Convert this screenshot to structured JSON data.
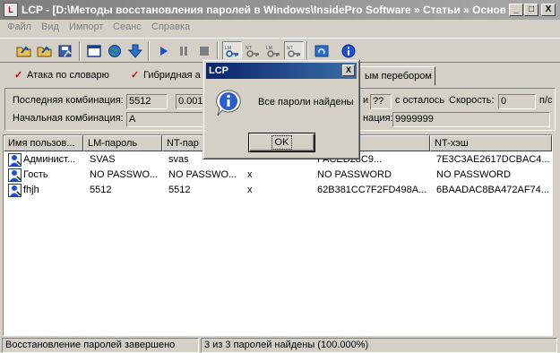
{
  "window": {
    "app_name": "LCP",
    "title": "LCP - [D:\\Методы восстановления паролей в Windows\\InsidePro Software » Статьи » Основ...",
    "controls": {
      "minimize": "_",
      "maximize": "□",
      "close": "X"
    }
  },
  "menu": [
    "Файл",
    "Вид",
    "Импорт",
    "Сеанс",
    "Справка"
  ],
  "toolbar": {
    "icons": [
      "open-folder-icon",
      "open-folder-icon",
      "save-icon",
      "new-window-icon",
      "globe-icon",
      "download-icon",
      "play-icon",
      "pause-icon",
      "stop-icon",
      "lm-key-icon",
      "nt-key-icon",
      "lm-nt-key-icon",
      "nt-key-icon",
      "refresh-icon",
      "info-icon"
    ]
  },
  "tabs": [
    {
      "label": "Атака по словарю",
      "checked": true
    },
    {
      "label": "Гибридная а",
      "checked": true
    },
    {
      "label": "ым перебором",
      "checked": false,
      "active": true
    }
  ],
  "stats": {
    "last_combination_label": "Последняя комбинация:",
    "last_combination_value": "5512",
    "progress_value": "0.001",
    "remaining_label_prefix": "и",
    "remaining_value": "??",
    "remaining_label": "с осталось",
    "speed_label": "Скорость:",
    "speed_value": "0",
    "speed_unit": "п/с",
    "start_combination_label": "Начальная комбинация:",
    "start_combination_value": "A",
    "end_combination_label": "нация:",
    "end_combination_value": "9999999"
  },
  "table": {
    "columns": [
      "Имя пользов...",
      "LM-пароль",
      "NT-пар",
      "",
      "",
      "NT-хэш"
    ],
    "rows": [
      {
        "user": "Админист...",
        "lm_password": "SVAS",
        "nt_password": "svas",
        "x": "",
        "lm_hash": "FACED28C9...",
        "nt_hash": "7E3C3AE2617DCBAC4..."
      },
      {
        "user": "Гость",
        "lm_password": "NO PASSWO...",
        "nt_password": "NO PASSWO...",
        "x": "x",
        "lm_hash": "NO PASSWORD",
        "nt_hash": "NO PASSWORD"
      },
      {
        "user": "fhjh",
        "lm_password": "5512",
        "nt_password": "5512",
        "x": "x",
        "lm_hash": "62B381CC7F2FD498A...",
        "nt_hash": "6BAADAC8BA472AF74..."
      }
    ]
  },
  "status": {
    "left": "Восстановление паролей завершено",
    "right": "3 из 3 паролей найдены (100.000%)"
  },
  "dialog": {
    "title": "LCP",
    "message": "Все пароли найдены",
    "ok_label": "OK",
    "close": "X",
    "icon": "info-icon"
  }
}
